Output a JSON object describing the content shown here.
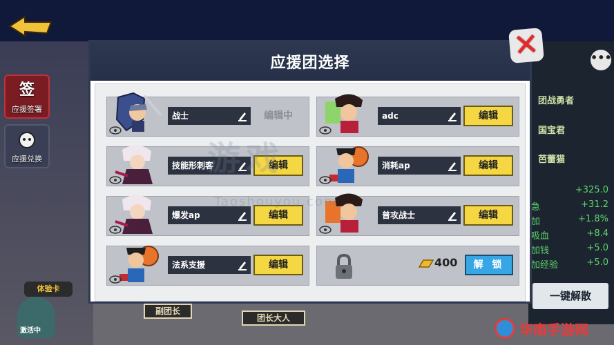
{
  "modal": {
    "title": "应援团选择",
    "close_label": "✕"
  },
  "slots": [
    {
      "name": "战士",
      "action": "编辑中",
      "state": "editing",
      "hero": "knight"
    },
    {
      "name": "adc",
      "action": "编辑",
      "state": "editable",
      "hero": "pompadour"
    },
    {
      "name": "技能形刺客",
      "action": "编辑",
      "state": "editable",
      "hero": "white-hair"
    },
    {
      "name": "消耗ap",
      "action": "编辑",
      "state": "editable",
      "hero": "basketball"
    },
    {
      "name": "爆发ap",
      "action": "编辑",
      "state": "editable",
      "hero": "white-hair"
    },
    {
      "name": "普攻战士",
      "action": "编辑",
      "state": "editable",
      "hero": "pompadour"
    },
    {
      "name": "法系支援",
      "action": "编辑",
      "state": "editable",
      "hero": "basketball"
    },
    {
      "name": "",
      "action": "解 锁",
      "state": "locked",
      "cost": "400"
    }
  ],
  "sidebar": {
    "item1_label": "应援签署",
    "item1_glyph": "签",
    "item2_label": "应援兑换"
  },
  "trial_card": "体验卡",
  "trial_sub": "激活中",
  "bottom_tags": [
    "副团长",
    "团长大人"
  ],
  "right_panel": {
    "menu": "•••",
    "names": [
      "团战勇者",
      "国宝君",
      "芭蕾猫"
    ],
    "stats": [
      {
        "label": "",
        "value": "+325.0"
      },
      {
        "label": "急",
        "value": "+31.2"
      },
      {
        "label": "加",
        "value": "+1.8%"
      },
      {
        "label": "吸血",
        "value": "+8.4"
      },
      {
        "label": "加钱",
        "value": "+5.0"
      },
      {
        "label": "加经验",
        "value": "+5.0"
      }
    ],
    "unlock_button": "一键解散"
  },
  "watermark": {
    "center": "游戏",
    "center_url": "Taoshouyou.com",
    "corner": "华南手游网"
  },
  "colors": {
    "edit_yellow": "#f4d743",
    "unlock_blue": "#36a6e4",
    "close_red": "#e22a2a",
    "header_navy": "#2d3850"
  }
}
